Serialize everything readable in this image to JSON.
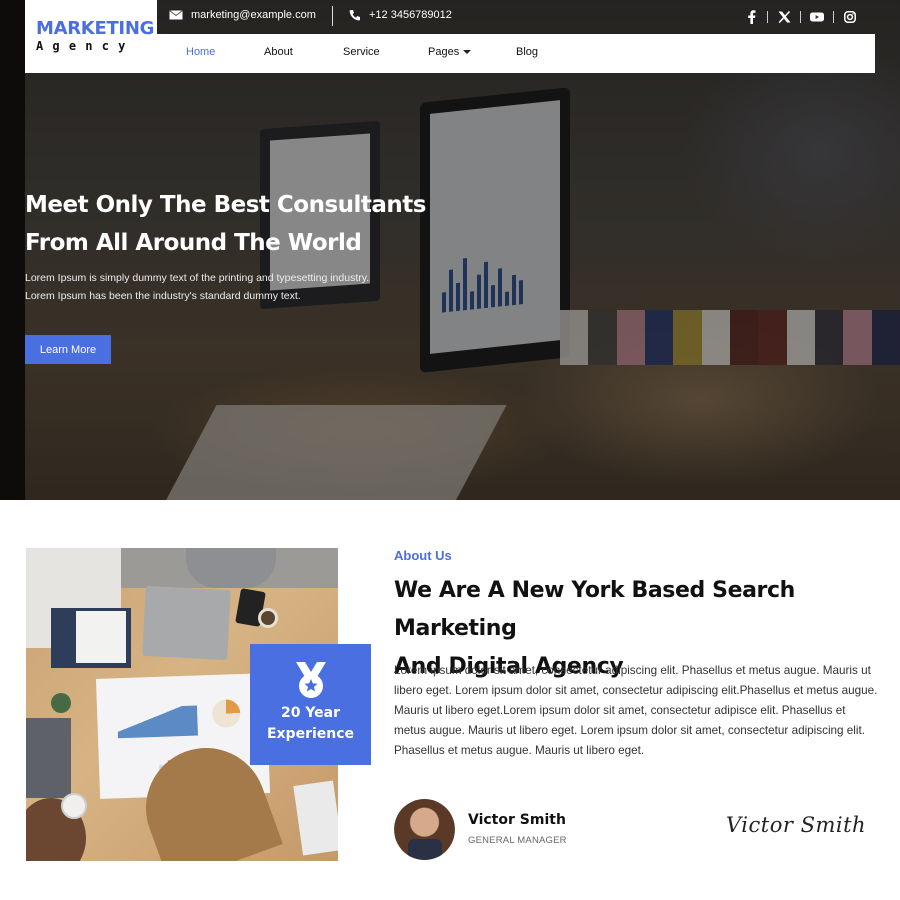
{
  "brand": {
    "name": "MARKETING",
    "tagline": "Agency"
  },
  "topbar": {
    "email": "marketing@example.com",
    "phone": "+12 3456789012",
    "socials": [
      {
        "icon": "facebook-icon",
        "label": "Facebook"
      },
      {
        "icon": "x-twitter-icon",
        "label": "X"
      },
      {
        "icon": "youtube-icon",
        "label": "YouTube"
      },
      {
        "icon": "instagram-icon",
        "label": "Instagram"
      }
    ]
  },
  "nav": {
    "items": [
      {
        "label": "Home",
        "active": true
      },
      {
        "label": "About",
        "active": false
      },
      {
        "label": "Service",
        "active": false
      },
      {
        "label": "Pages",
        "active": false,
        "dropdown": true
      },
      {
        "label": "Blog",
        "active": false
      }
    ]
  },
  "hero": {
    "title_line1": "Meet Only The Best Consultants",
    "title_line2": "From All Around The World",
    "text_line1": "Lorem Ipsum is simply dummy text of the printing and typesetting industry.",
    "text_line2": "Lorem Ipsum has been the industry's standard dummy text.",
    "cta_label": "Learn More"
  },
  "about": {
    "tag": "About Us",
    "title_line1": "We Are A New York Based Search Marketing",
    "title_line2": "And Digital Agency",
    "text": "Lorem ipsum dolor sit amet, consectetur adipiscing elit. Phasellus et metus augue. Mauris ut libero eget. Lorem ipsum dolor sit amet, consectetur adipiscing elit.Phasellus et metus augue. Mauris ut libero eget.Lorem ipsum dolor sit amet, consectetur adipisce elit. Phasellus et metus augue. Mauris ut libero eget. Lorem ipsum dolor sit amet, consectetur adipiscing elit. Phasellus et metus augue. Mauris ut libero eget.",
    "experience_line1": "20 Year",
    "experience_line2": "Experience",
    "person_name": "Victor Smith",
    "person_role": "GENERAL MANAGER",
    "signature": "Victor Smith"
  },
  "colors": {
    "accent": "#4a6fe0",
    "text": "#111111",
    "muted": "#666666"
  }
}
